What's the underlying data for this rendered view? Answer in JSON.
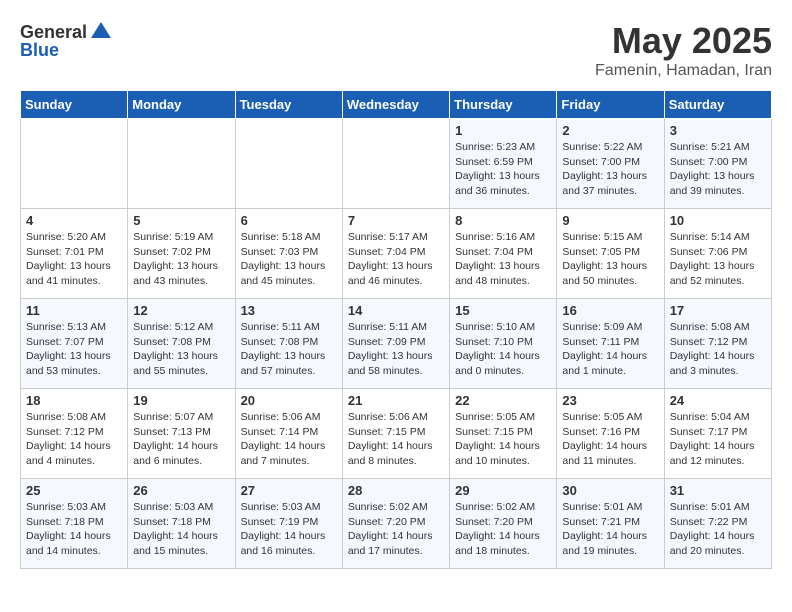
{
  "header": {
    "logo_general": "General",
    "logo_blue": "Blue",
    "month_title": "May 2025",
    "location": "Famenin, Hamadan, Iran"
  },
  "days_of_week": [
    "Sunday",
    "Monday",
    "Tuesday",
    "Wednesday",
    "Thursday",
    "Friday",
    "Saturday"
  ],
  "weeks": [
    [
      {
        "day": "",
        "info": ""
      },
      {
        "day": "",
        "info": ""
      },
      {
        "day": "",
        "info": ""
      },
      {
        "day": "",
        "info": ""
      },
      {
        "day": "1",
        "info": "Sunrise: 5:23 AM\nSunset: 6:59 PM\nDaylight: 13 hours\nand 36 minutes."
      },
      {
        "day": "2",
        "info": "Sunrise: 5:22 AM\nSunset: 7:00 PM\nDaylight: 13 hours\nand 37 minutes."
      },
      {
        "day": "3",
        "info": "Sunrise: 5:21 AM\nSunset: 7:00 PM\nDaylight: 13 hours\nand 39 minutes."
      }
    ],
    [
      {
        "day": "4",
        "info": "Sunrise: 5:20 AM\nSunset: 7:01 PM\nDaylight: 13 hours\nand 41 minutes."
      },
      {
        "day": "5",
        "info": "Sunrise: 5:19 AM\nSunset: 7:02 PM\nDaylight: 13 hours\nand 43 minutes."
      },
      {
        "day": "6",
        "info": "Sunrise: 5:18 AM\nSunset: 7:03 PM\nDaylight: 13 hours\nand 45 minutes."
      },
      {
        "day": "7",
        "info": "Sunrise: 5:17 AM\nSunset: 7:04 PM\nDaylight: 13 hours\nand 46 minutes."
      },
      {
        "day": "8",
        "info": "Sunrise: 5:16 AM\nSunset: 7:04 PM\nDaylight: 13 hours\nand 48 minutes."
      },
      {
        "day": "9",
        "info": "Sunrise: 5:15 AM\nSunset: 7:05 PM\nDaylight: 13 hours\nand 50 minutes."
      },
      {
        "day": "10",
        "info": "Sunrise: 5:14 AM\nSunset: 7:06 PM\nDaylight: 13 hours\nand 52 minutes."
      }
    ],
    [
      {
        "day": "11",
        "info": "Sunrise: 5:13 AM\nSunset: 7:07 PM\nDaylight: 13 hours\nand 53 minutes."
      },
      {
        "day": "12",
        "info": "Sunrise: 5:12 AM\nSunset: 7:08 PM\nDaylight: 13 hours\nand 55 minutes."
      },
      {
        "day": "13",
        "info": "Sunrise: 5:11 AM\nSunset: 7:08 PM\nDaylight: 13 hours\nand 57 minutes."
      },
      {
        "day": "14",
        "info": "Sunrise: 5:11 AM\nSunset: 7:09 PM\nDaylight: 13 hours\nand 58 minutes."
      },
      {
        "day": "15",
        "info": "Sunrise: 5:10 AM\nSunset: 7:10 PM\nDaylight: 14 hours\nand 0 minutes."
      },
      {
        "day": "16",
        "info": "Sunrise: 5:09 AM\nSunset: 7:11 PM\nDaylight: 14 hours\nand 1 minute."
      },
      {
        "day": "17",
        "info": "Sunrise: 5:08 AM\nSunset: 7:12 PM\nDaylight: 14 hours\nand 3 minutes."
      }
    ],
    [
      {
        "day": "18",
        "info": "Sunrise: 5:08 AM\nSunset: 7:12 PM\nDaylight: 14 hours\nand 4 minutes."
      },
      {
        "day": "19",
        "info": "Sunrise: 5:07 AM\nSunset: 7:13 PM\nDaylight: 14 hours\nand 6 minutes."
      },
      {
        "day": "20",
        "info": "Sunrise: 5:06 AM\nSunset: 7:14 PM\nDaylight: 14 hours\nand 7 minutes."
      },
      {
        "day": "21",
        "info": "Sunrise: 5:06 AM\nSunset: 7:15 PM\nDaylight: 14 hours\nand 8 minutes."
      },
      {
        "day": "22",
        "info": "Sunrise: 5:05 AM\nSunset: 7:15 PM\nDaylight: 14 hours\nand 10 minutes."
      },
      {
        "day": "23",
        "info": "Sunrise: 5:05 AM\nSunset: 7:16 PM\nDaylight: 14 hours\nand 11 minutes."
      },
      {
        "day": "24",
        "info": "Sunrise: 5:04 AM\nSunset: 7:17 PM\nDaylight: 14 hours\nand 12 minutes."
      }
    ],
    [
      {
        "day": "25",
        "info": "Sunrise: 5:03 AM\nSunset: 7:18 PM\nDaylight: 14 hours\nand 14 minutes."
      },
      {
        "day": "26",
        "info": "Sunrise: 5:03 AM\nSunset: 7:18 PM\nDaylight: 14 hours\nand 15 minutes."
      },
      {
        "day": "27",
        "info": "Sunrise: 5:03 AM\nSunset: 7:19 PM\nDaylight: 14 hours\nand 16 minutes."
      },
      {
        "day": "28",
        "info": "Sunrise: 5:02 AM\nSunset: 7:20 PM\nDaylight: 14 hours\nand 17 minutes."
      },
      {
        "day": "29",
        "info": "Sunrise: 5:02 AM\nSunset: 7:20 PM\nDaylight: 14 hours\nand 18 minutes."
      },
      {
        "day": "30",
        "info": "Sunrise: 5:01 AM\nSunset: 7:21 PM\nDaylight: 14 hours\nand 19 minutes."
      },
      {
        "day": "31",
        "info": "Sunrise: 5:01 AM\nSunset: 7:22 PM\nDaylight: 14 hours\nand 20 minutes."
      }
    ]
  ]
}
